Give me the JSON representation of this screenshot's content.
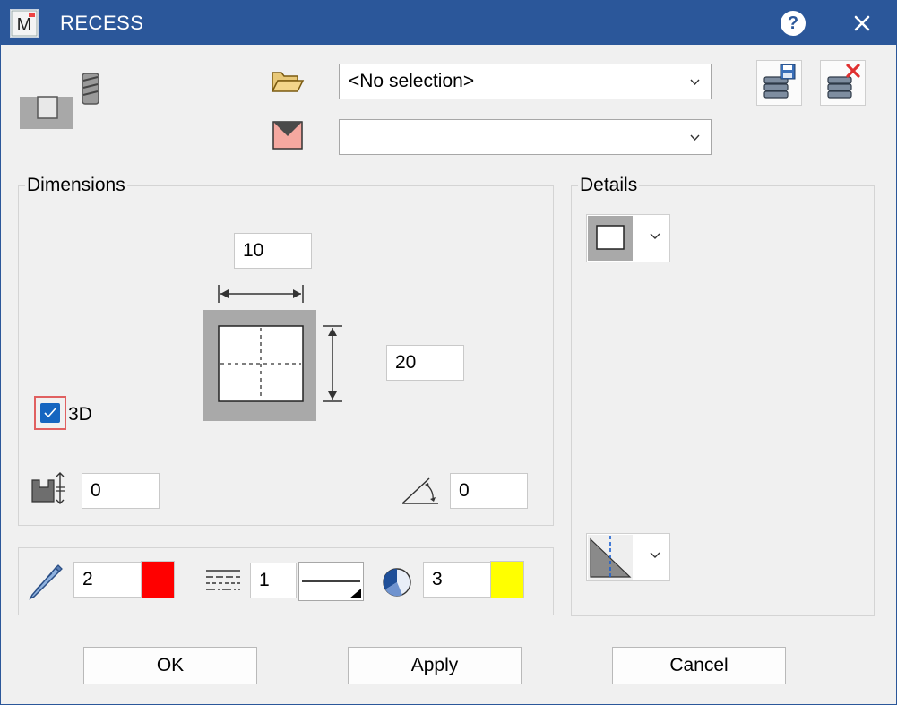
{
  "window": {
    "title": "RECESS",
    "app_icon_letter": "M"
  },
  "top": {
    "selection_combo": {
      "value": "<No selection>"
    },
    "second_combo": {
      "value": ""
    }
  },
  "dimensions": {
    "label": "Dimensions",
    "width_value": "10",
    "height_value": "20",
    "checkbox_3d": {
      "label": "3D",
      "checked": true
    },
    "depth_value": "0",
    "angle_value": "0"
  },
  "details": {
    "label": "Details"
  },
  "format": {
    "pen_value": "2",
    "pen_color": "#ff0000",
    "line_value": "1",
    "fill_value": "3",
    "fill_color": "#ffff00"
  },
  "buttons": {
    "ok": "OK",
    "apply": "Apply",
    "cancel": "Cancel"
  }
}
